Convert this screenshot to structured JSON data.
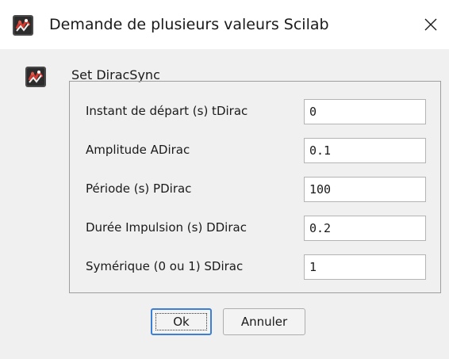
{
  "window": {
    "title": "Demande de plusieurs valeurs Scilab",
    "icon": "scilab-icon",
    "close_icon": "close-icon"
  },
  "block": {
    "icon": "scilab-block-icon",
    "label": "Set DiracSync"
  },
  "fields": [
    {
      "label": "Instant de départ (s) tDirac",
      "value": "0"
    },
    {
      "label": "Amplitude ADirac",
      "value": "0.1"
    },
    {
      "label": "Période (s) PDirac",
      "value": "100"
    },
    {
      "label": "Durée Impulsion (s) DDirac",
      "value": "0.2"
    },
    {
      "label": "Symérique (0 ou 1) SDirac",
      "value": "1"
    }
  ],
  "buttons": {
    "ok": "Ok",
    "cancel": "Annuler"
  },
  "colors": {
    "focus_border": "#3b7fd6",
    "background": "#f0f0f0",
    "titlebar": "#ffffff"
  }
}
